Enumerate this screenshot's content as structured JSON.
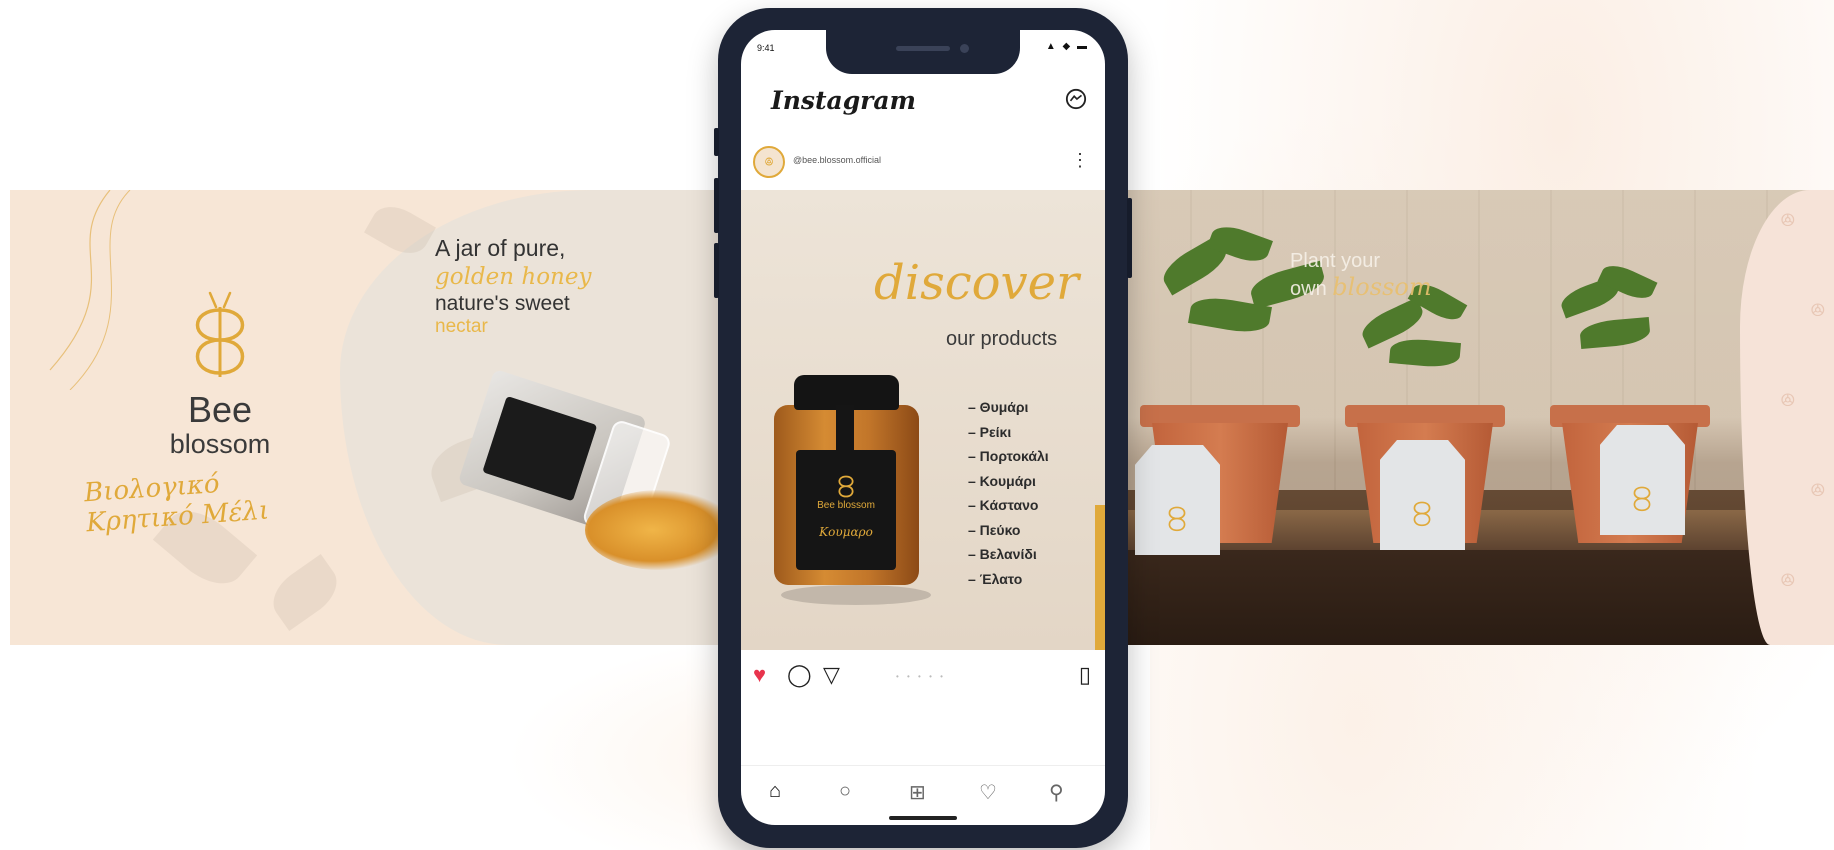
{
  "left_banner": {
    "brand_name": "Bee",
    "brand_sub": "blossom",
    "brand_script": "Βιολογικό Κρητικό Μέλι",
    "tagline_line1": "A jar of pure,",
    "tagline_line2": "golden honey",
    "tagline_line3": "nature's sweet",
    "tagline_line4": "nectar"
  },
  "phone": {
    "status_time": "9:41",
    "status_icons": "▲ ◆ ▬",
    "app_title": "Instagram",
    "messenger_icon": "messenger-icon",
    "post": {
      "username": "@bee.blossom.official",
      "more_icon": "⋮",
      "headline_script": "discover",
      "headline_sub": "our products",
      "products": [
        "– Θυμάρι",
        "– Ρείκι",
        "– Πορτοκάλι",
        "– Κουμάρι",
        "– Κάστανο",
        "– Πεύκο",
        "– Βελανίδι",
        "– Έλατο"
      ],
      "jar_brand": "Bee blossom",
      "jar_variety": "Κουμαρο"
    },
    "actions": {
      "like": "♥",
      "comment": "◯",
      "share": "▽",
      "carousel_dots": "• • • • •",
      "save": "▯"
    },
    "nav": {
      "home": "⌂",
      "search": "○",
      "add": "⊞",
      "activity": "♡",
      "profile": "⚲"
    }
  },
  "right_banner": {
    "headline1": "Plant your",
    "headline2_plain": "own",
    "headline2_script": "blossom"
  },
  "colors": {
    "gold": "#e0a93a",
    "phone_frame": "#1d2436",
    "like_red": "#e8344d"
  }
}
